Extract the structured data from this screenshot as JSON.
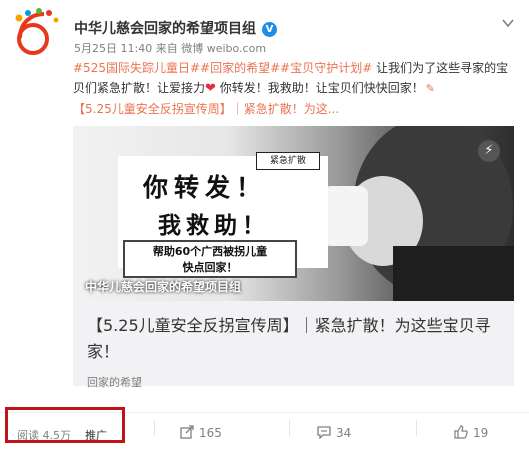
{
  "account": {
    "name": "中华儿慈会回家的希望项目组",
    "verified_badge": "V",
    "time": "5月25日 11:40",
    "source_prefix": "来自",
    "source": "微博 weibo.com"
  },
  "post": {
    "tags": [
      "#525国际失踪儿童日#",
      "#回家的希望#",
      "#宝贝守护计划#"
    ],
    "text1": " 让我们为了这些寻家的宝贝们紧急扩散！让爱接力",
    "text2": " 你转发！我救助！让宝贝们快快回家！",
    "heart": "❤",
    "edit_icon": "✎",
    "link_text": "【5.25儿童安全反拐宣传周】｜紧急扩散！为这..."
  },
  "card": {
    "image": {
      "sticker": "紧急扩散",
      "line1": "你转发！",
      "line2": "我救助！",
      "box_line1": "帮助60个广西被拐儿童",
      "box_line2": "快点回家！",
      "caption": "中华儿慈会回家的希望项目组",
      "play_icon": "⚡"
    },
    "title": "【5.25儿童安全反拐宣传周】｜紧急扩散！为这些宝贝寻家！",
    "source": "回家的希望"
  },
  "footer": {
    "reads": "阅读 4.5万",
    "promote": "推广",
    "reposts": "165",
    "comments": "34",
    "likes": "19"
  },
  "colors": {
    "accent": "#eb7350",
    "highlight": "#c0131a",
    "verified": "#1f8ee6"
  }
}
